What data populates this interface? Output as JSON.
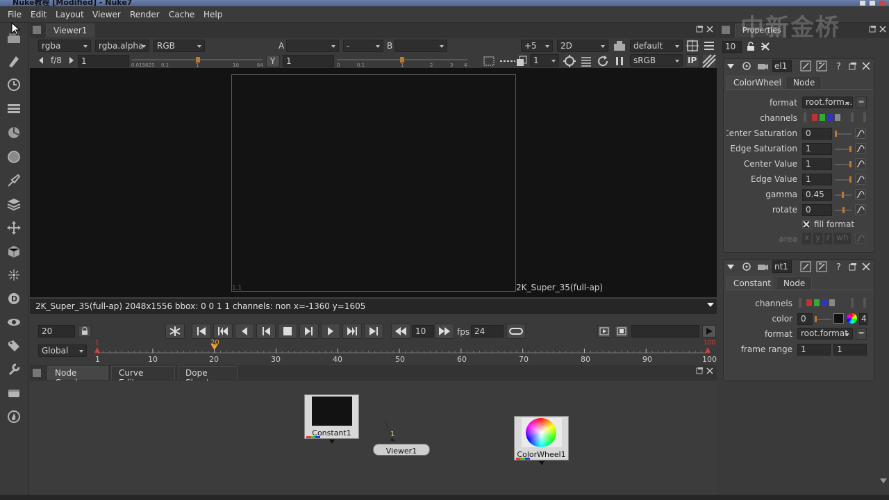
{
  "window": {
    "title": "Nuke教程 [Modified] - Nuke7"
  },
  "menu": [
    "File",
    "Edit",
    "Layout",
    "Viewer",
    "Render",
    "Cache",
    "Help"
  ],
  "viewer": {
    "tab": "Viewer1",
    "channels": "rgba",
    "alpha": "rgba.alpha",
    "display_channels": "RGB",
    "a_label": "A",
    "a_input": "",
    "wipe": "-",
    "b_label": "B",
    "b_input": "",
    "zoom": "+5",
    "view_mode": "2D",
    "lut_default": "default",
    "fstop": "f/8",
    "gain": "1",
    "gain_ticks": [
      "0.015625",
      "0.1",
      "1",
      "10",
      "64"
    ],
    "y_label": "Y",
    "gamma": "1",
    "gamma_ticks": [
      "0",
      "0.1",
      "1",
      "2",
      "3",
      "4"
    ],
    "proxy": "1",
    "colorspace": "sRGB",
    "ip_label": "IP",
    "frame_origin": "1,1",
    "format_label": "2K_Super_35(full-ap)",
    "info": "2K_Super_35(full-ap) 2048x1556 bbox: 0 0 1 1 channels: non  x=-1360 y=1605"
  },
  "timeline": {
    "current_frame": "20",
    "playback_frame": "10",
    "fps_label": "fps",
    "fps": "24",
    "scope": "Global",
    "start_marker": "1",
    "current_marker": "20",
    "end_marker": "100",
    "ruler": [
      "1",
      "10",
      "20",
      "30",
      "40",
      "50",
      "60",
      "70",
      "80",
      "90",
      "100"
    ]
  },
  "node_graph": {
    "tabs": [
      "Node Graph",
      "Curve Editor",
      "Dope Sheet"
    ],
    "nodes": {
      "constant": "Constant1",
      "viewer": "Viewer1",
      "viewer_input": "1",
      "colorwheel": "ColorWheel1"
    }
  },
  "properties": {
    "title": "Properties",
    "max_panels": "10",
    "watermark": "中新金桥",
    "colorwheel_panel": {
      "name_field": "el1",
      "tabs": [
        "ColorWheel",
        "Node"
      ],
      "format_label": "format",
      "format_value": "root.form...",
      "channels_label": "channels",
      "knobs": [
        {
          "label": "Center Saturation",
          "value": "0"
        },
        {
          "label": "Edge Saturation",
          "value": "1"
        },
        {
          "label": "Center Value",
          "value": "1"
        },
        {
          "label": "Edge Value",
          "value": "1"
        },
        {
          "label": "gamma",
          "value": "0.45"
        },
        {
          "label": "rotate",
          "value": "0"
        }
      ],
      "fill_format": "fill format",
      "area_label": "area",
      "area_fields": [
        "x",
        "y",
        "r",
        "wh"
      ]
    },
    "constant_panel": {
      "name_field": "nt1",
      "tabs": [
        "Constant",
        "Node"
      ],
      "channels_label": "channels",
      "color_label": "color",
      "color_value": "0",
      "color_count": "4",
      "format_label": "format",
      "format_value": "root.format",
      "frame_range_label": "frame range",
      "frame_range": [
        "1",
        "1"
      ]
    }
  }
}
